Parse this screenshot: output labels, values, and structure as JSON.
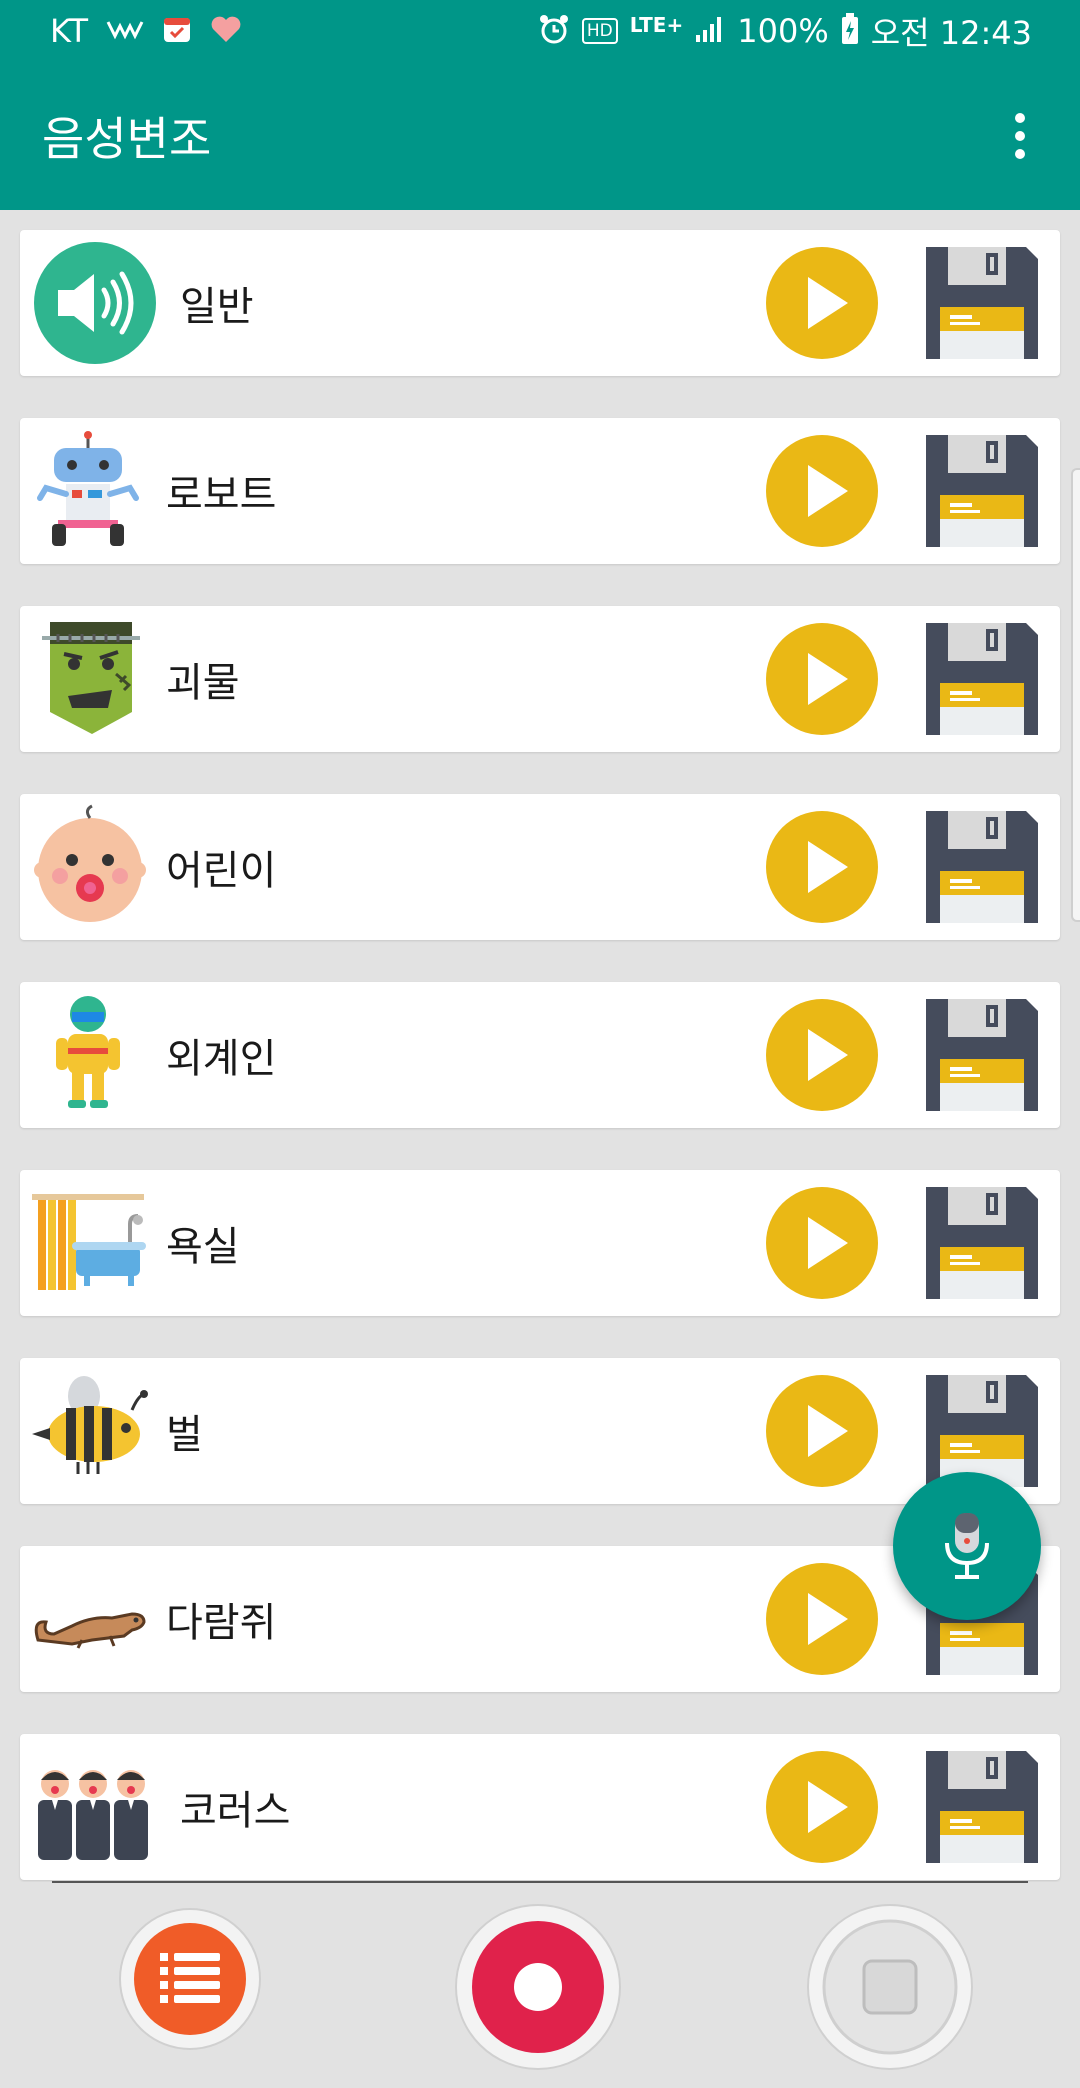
{
  "status_bar": {
    "carrier": "KT",
    "lte": "LTE+",
    "battery": "100%",
    "time": "오전 12:43"
  },
  "app_bar": {
    "title": "음성변조"
  },
  "colors": {
    "primary": "#009688",
    "play": "#EAB815",
    "save_dark": "#454C5C",
    "record": "#E0224B",
    "list_button": "#F05C28"
  },
  "voices": [
    {
      "label": "일반",
      "icon": "speaker-icon"
    },
    {
      "label": "로보트",
      "icon": "robot-icon"
    },
    {
      "label": "괴물",
      "icon": "monster-icon"
    },
    {
      "label": "어린이",
      "icon": "baby-icon"
    },
    {
      "label": "외계인",
      "icon": "alien-icon"
    },
    {
      "label": "욕실",
      "icon": "bathtub-icon"
    },
    {
      "label": "벌",
      "icon": "bee-icon"
    },
    {
      "label": "다람쥐",
      "icon": "squirrel-icon"
    },
    {
      "label": "코러스",
      "icon": "chorus-icon"
    }
  ],
  "bottom_bar": {
    "buttons": [
      "list-button",
      "record-button",
      "stop-button"
    ]
  }
}
